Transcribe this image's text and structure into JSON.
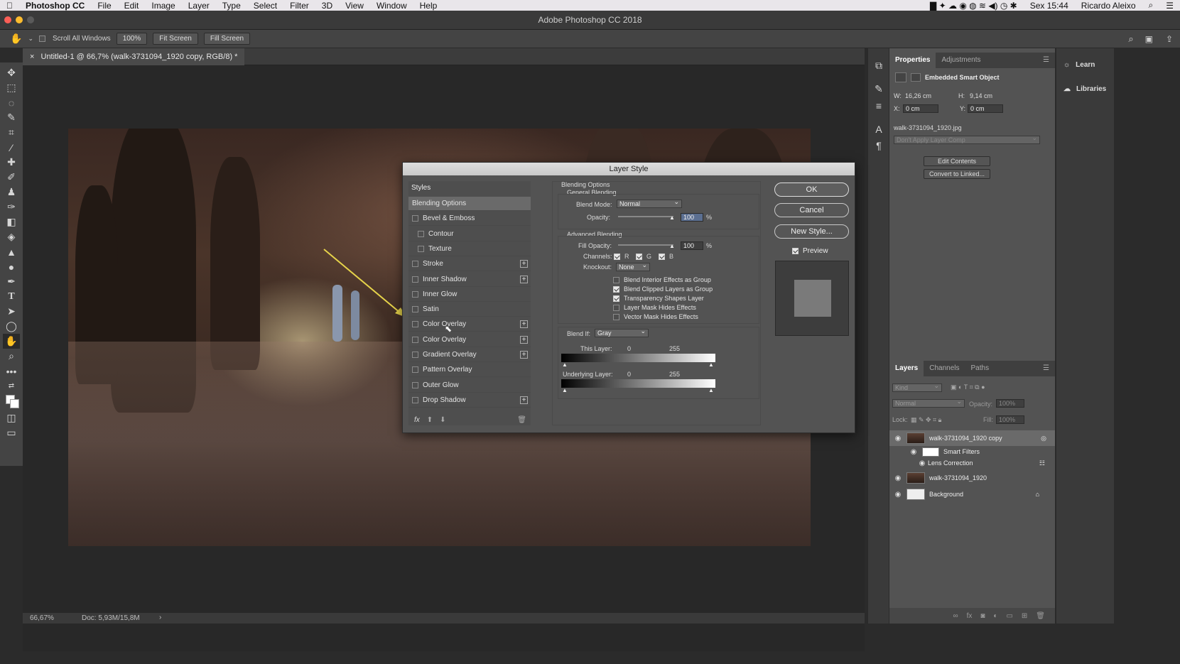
{
  "menubar": {
    "app": "Photoshop CC",
    "items": [
      "File",
      "Edit",
      "Image",
      "Layer",
      "Type",
      "Select",
      "Filter",
      "3D",
      "View",
      "Window",
      "Help"
    ],
    "clock": "Sex 15:44",
    "user": "Ricardo Aleixo"
  },
  "window_title": "Adobe Photoshop CC 2018",
  "options_bar": {
    "scroll_all": "Scroll All Windows",
    "zoom_100": "100%",
    "fit_screen": "Fit Screen",
    "fill_screen": "Fill Screen"
  },
  "document": {
    "tab_title": "Untitled-1 @ 66,7% (walk-3731094_1920 copy, RGB/8) *",
    "zoom": "66,67%",
    "doc_size": "Doc: 5,93M/15,8M"
  },
  "layer_style": {
    "title": "Layer Style",
    "styles_header": "Styles",
    "items": [
      {
        "label": "Blending Options",
        "checkbox": false,
        "plus": false,
        "selected": true,
        "indent": false
      },
      {
        "label": "Bevel & Emboss",
        "checkbox": true,
        "plus": false,
        "indent": false
      },
      {
        "label": "Contour",
        "checkbox": true,
        "plus": false,
        "indent": true
      },
      {
        "label": "Texture",
        "checkbox": true,
        "plus": false,
        "indent": true
      },
      {
        "label": "Stroke",
        "checkbox": true,
        "plus": true,
        "indent": false
      },
      {
        "label": "Inner Shadow",
        "checkbox": true,
        "plus": true,
        "indent": false
      },
      {
        "label": "Inner Glow",
        "checkbox": true,
        "plus": false,
        "indent": false
      },
      {
        "label": "Satin",
        "checkbox": true,
        "plus": false,
        "indent": false
      },
      {
        "label": "Color Overlay",
        "checkbox": true,
        "plus": true,
        "indent": false
      },
      {
        "label": "Color Overlay",
        "checkbox": true,
        "plus": true,
        "indent": false
      },
      {
        "label": "Gradient Overlay",
        "checkbox": true,
        "plus": true,
        "indent": false
      },
      {
        "label": "Pattern Overlay",
        "checkbox": true,
        "plus": false,
        "indent": false
      },
      {
        "label": "Outer Glow",
        "checkbox": true,
        "plus": false,
        "indent": false
      },
      {
        "label": "Drop Shadow",
        "checkbox": true,
        "plus": true,
        "indent": false
      }
    ],
    "fx_label": "fx",
    "blending": {
      "header": "Blending Options",
      "general": "General Blending",
      "blend_mode_label": "Blend Mode:",
      "blend_mode": "Normal",
      "opacity_label": "Opacity:",
      "opacity": "100",
      "percent": "%",
      "advanced": "Advanced Blending",
      "fill_opacity_label": "Fill Opacity:",
      "fill_opacity": "100",
      "channels_label": "Channels:",
      "channel_r": "R",
      "channel_g": "G",
      "channel_b": "B",
      "knockout_label": "Knockout:",
      "knockout": "None",
      "options": [
        {
          "label": "Blend Interior Effects as Group",
          "checked": false
        },
        {
          "label": "Blend Clipped Layers as Group",
          "checked": true
        },
        {
          "label": "Transparency Shapes Layer",
          "checked": true
        },
        {
          "label": "Layer Mask Hides Effects",
          "checked": false
        },
        {
          "label": "Vector Mask Hides Effects",
          "checked": false
        }
      ],
      "blend_if_label": "Blend If:",
      "blend_if": "Gray",
      "this_layer_label": "This Layer:",
      "this_layer_min": "0",
      "this_layer_max": "255",
      "underlying_label": "Underlying Layer:",
      "underlying_min": "0",
      "underlying_max": "255"
    },
    "buttons": {
      "ok": "OK",
      "cancel": "Cancel",
      "new_style": "New Style...",
      "preview": "Preview"
    }
  },
  "properties": {
    "tabs": [
      "Properties",
      "Adjustments"
    ],
    "kind": "Embedded Smart Object",
    "w_label": "W:",
    "w": "16,26 cm",
    "h_label": "H:",
    "h": "9,14 cm",
    "x_label": "X:",
    "x": "0 cm",
    "y_label": "Y:",
    "y": "0 cm",
    "filename": "walk-3731094_1920.jpg",
    "layer_comp": "Don't Apply Layer Comp",
    "edit_contents": "Edit Contents",
    "convert": "Convert to Linked..."
  },
  "learn_panel": {
    "learn": "Learn",
    "libraries": "Libraries"
  },
  "layers": {
    "tabs": [
      "Layers",
      "Channels",
      "Paths"
    ],
    "kind_placeholder": "Kind",
    "blend": "Normal",
    "opacity_label": "Opacity:",
    "opacity": "100%",
    "lock_label": "Lock:",
    "fill_label": "Fill:",
    "fill": "100%",
    "rows": {
      "copy": "walk-3731094_1920 copy",
      "smart_filters": "Smart Filters",
      "lens": "Lens Correction",
      "walk": "walk-3731094_1920",
      "background": "Background"
    }
  }
}
